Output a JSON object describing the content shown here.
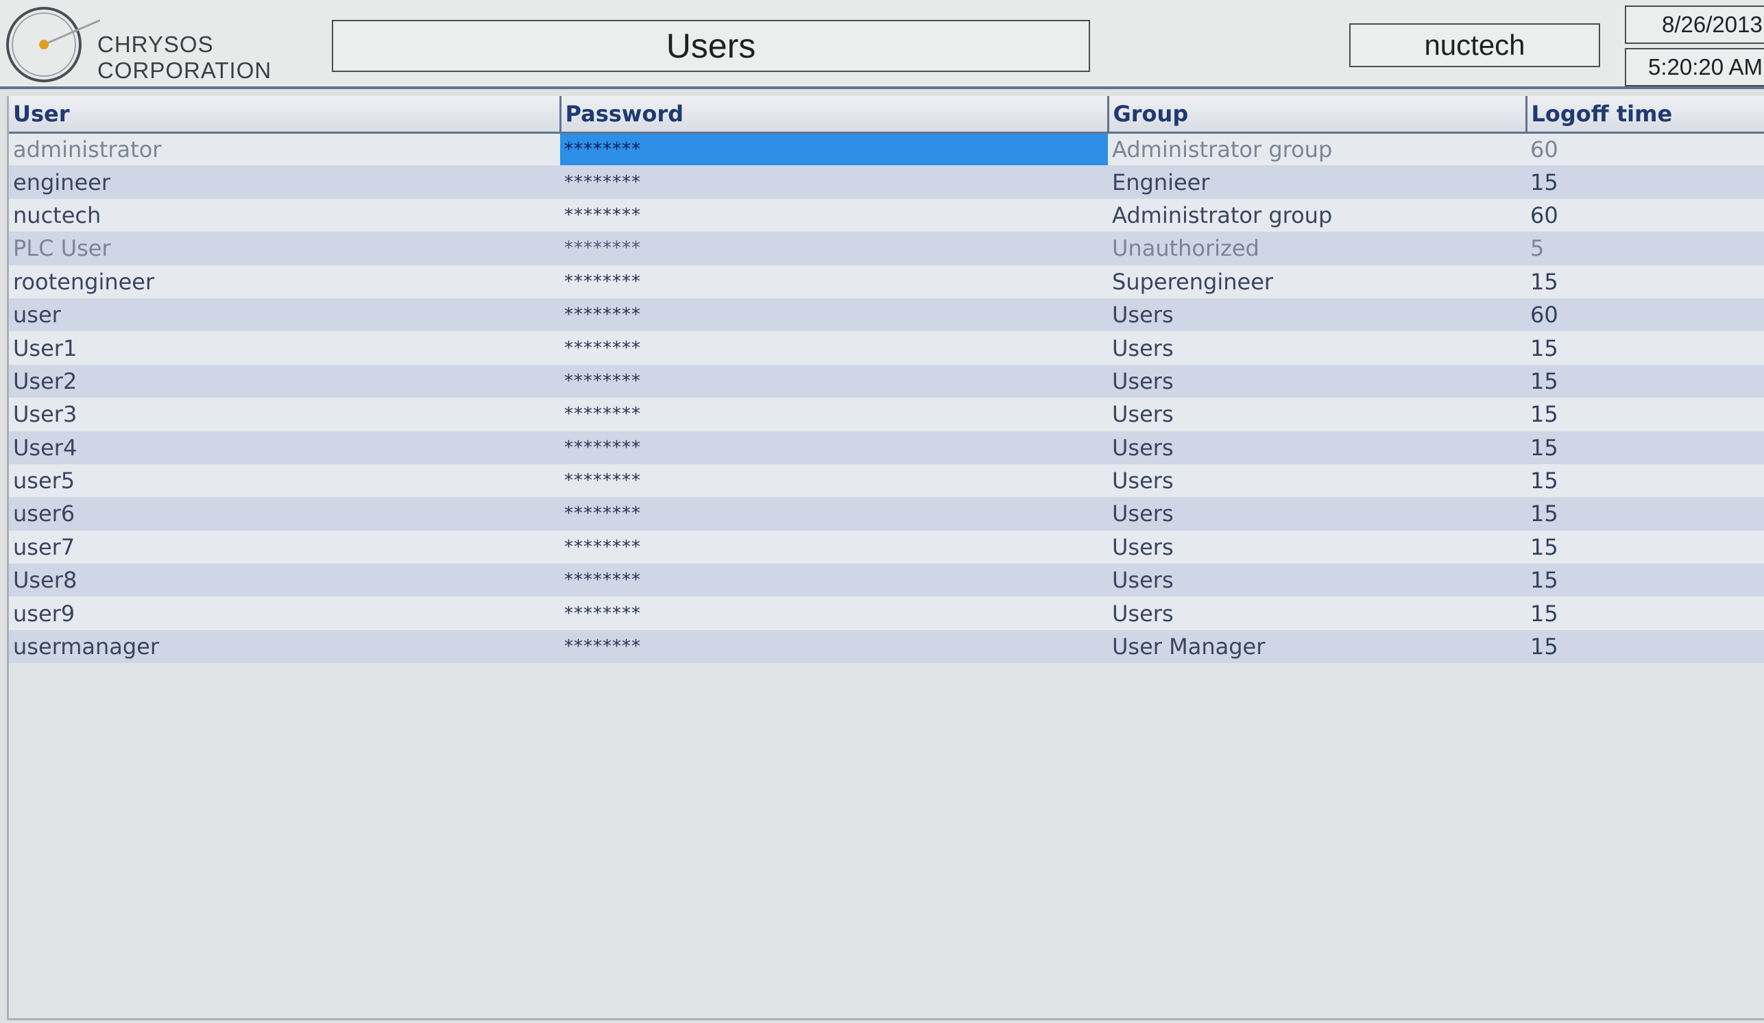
{
  "header": {
    "company_line1": "CHRYSOS",
    "company_line2": "CORPORATION",
    "screen_title": "Users",
    "current_user": "nuctech",
    "date": "8/26/2013",
    "time": "5:20:20 AM"
  },
  "table": {
    "columns": [
      "User",
      "Password",
      "Group",
      "Logoff time"
    ],
    "rows": [
      {
        "user": "administrator",
        "password": "********",
        "group": "Administrator group",
        "logoff": "60"
      },
      {
        "user": "engineer",
        "password": "********",
        "group": "Engnieer",
        "logoff": "15"
      },
      {
        "user": "nuctech",
        "password": "********",
        "group": "Administrator group",
        "logoff": "60"
      },
      {
        "user": "PLC User",
        "password": "********",
        "group": "Unauthorized",
        "logoff": "5"
      },
      {
        "user": "rootengineer",
        "password": "********",
        "group": "Superengineer",
        "logoff": "15"
      },
      {
        "user": "user",
        "password": "********",
        "group": "Users",
        "logoff": "60"
      },
      {
        "user": "User1",
        "password": "********",
        "group": "Users",
        "logoff": "15"
      },
      {
        "user": "User2",
        "password": "********",
        "group": "Users",
        "logoff": "15"
      },
      {
        "user": "User3",
        "password": "********",
        "group": "Users",
        "logoff": "15"
      },
      {
        "user": "User4",
        "password": "********",
        "group": "Users",
        "logoff": "15"
      },
      {
        "user": "user5",
        "password": "********",
        "group": "Users",
        "logoff": "15"
      },
      {
        "user": "user6",
        "password": "********",
        "group": "Users",
        "logoff": "15"
      },
      {
        "user": "user7",
        "password": "********",
        "group": "Users",
        "logoff": "15"
      },
      {
        "user": "User8",
        "password": "********",
        "group": "Users",
        "logoff": "15"
      },
      {
        "user": "user9",
        "password": "********",
        "group": "Users",
        "logoff": "15"
      },
      {
        "user": "usermanager",
        "password": "********",
        "group": "User Manager",
        "logoff": "15"
      }
    ]
  },
  "colors": {
    "header_text": "#1f3a70",
    "row_alt": "#cfd7e6",
    "selection": "#2d8fe6",
    "accent_border": "#5f7390",
    "logo_dot": "#e0a020"
  }
}
